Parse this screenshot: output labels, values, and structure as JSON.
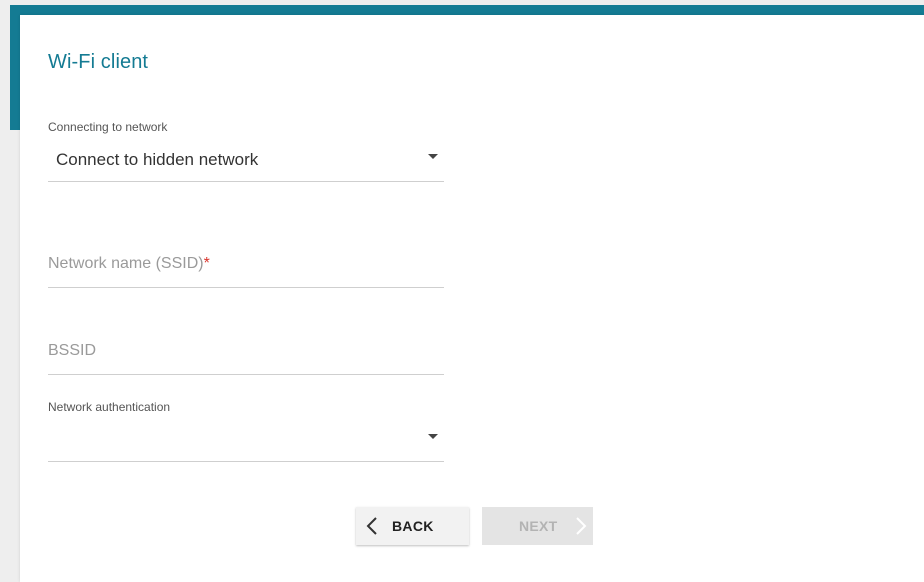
{
  "page": {
    "title": "Wi-Fi client"
  },
  "form": {
    "connecting": {
      "label": "Connecting to network",
      "value": "Connect to hidden network"
    },
    "ssid": {
      "placeholder": "Network name (SSID)",
      "required_mark": "*"
    },
    "bssid": {
      "placeholder": "BSSID"
    },
    "auth": {
      "label": "Network authentication",
      "value": ""
    }
  },
  "buttons": {
    "back": "BACK",
    "next": "NEXT"
  },
  "icons": {
    "back": "chevron-left-icon",
    "next": "chevron-right-icon",
    "dropdown": "caret-down-icon"
  },
  "colors": {
    "accent": "#147b93",
    "required": "#d9332b"
  }
}
